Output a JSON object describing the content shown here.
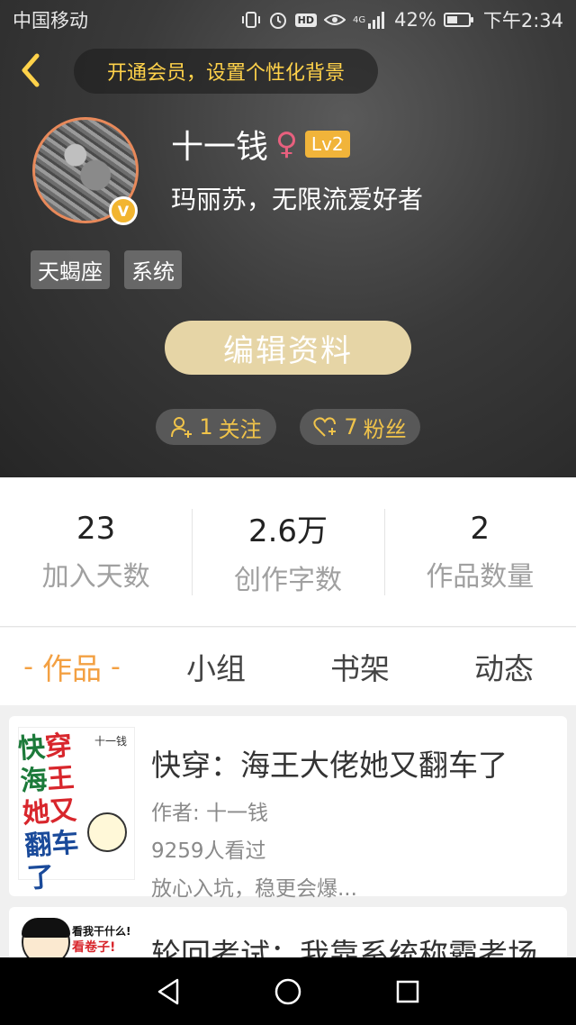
{
  "status_bar": {
    "carrier": "中国移动",
    "network": "4G",
    "battery": "42%",
    "time": "下午2:34"
  },
  "header": {
    "vip_banner": "开通会员，设置个性化背景"
  },
  "profile": {
    "username": "十一钱",
    "gender_symbol": "♀",
    "level": "Lv2",
    "verified_badge": "V",
    "bio": "玛丽苏，无限流爱好者",
    "tags": [
      "天蝎座",
      "系统"
    ],
    "edit_button": "编辑资料",
    "following_count": "1",
    "following_label": "关注",
    "fans_count": "7",
    "fans_label": "粉丝"
  },
  "stats": [
    {
      "value": "23",
      "label": "加入天数"
    },
    {
      "value": "2.6万",
      "label": "创作字数"
    },
    {
      "value": "2",
      "label": "作品数量"
    }
  ],
  "tabs": [
    {
      "label": "作品",
      "active": true
    },
    {
      "label": "小组",
      "active": false
    },
    {
      "label": "书架",
      "active": false
    },
    {
      "label": "动态",
      "active": false
    }
  ],
  "books": [
    {
      "title": "快穿：海王大佬她又翻车了",
      "author": "作者: 十一钱",
      "views": "9259人看过",
      "description": "放心入坑，稳更会爆...",
      "cover_text": [
        "快",
        "穿",
        "海",
        "王",
        "她",
        "又",
        "翻",
        "车",
        "了"
      ],
      "cover_author": "十一钱"
    },
    {
      "title": "轮回考试：我靠系统称霸考场",
      "cover_text": [
        "看我干什么!",
        "看卷子!"
      ]
    }
  ],
  "colors": {
    "accent": "#f3a042",
    "vip_text": "#ffd24a",
    "level_badge": "#f1b43a",
    "edit_button": "#e6d5a6",
    "gender": "#e8607e"
  },
  "icons": {
    "back": "chevron-left-icon",
    "following": "user-plus-icon",
    "fans": "heart-plus-icon",
    "nav_back": "triangle-back-icon",
    "nav_home": "circle-home-icon",
    "nav_recent": "square-recent-icon"
  }
}
